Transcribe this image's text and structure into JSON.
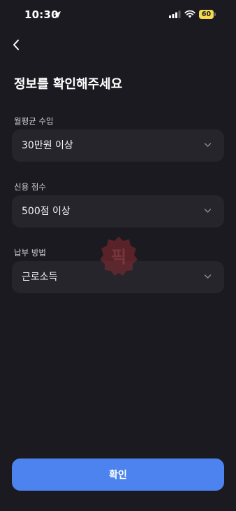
{
  "status_bar": {
    "time": "10:30",
    "battery": "60",
    "icons": [
      "location-arrow-icon",
      "signal-bars-icon",
      "wifi-icon",
      "battery-icon"
    ],
    "battery_color": "#f2d94e"
  },
  "nav": {
    "back_icon": "chevron-left-icon"
  },
  "page": {
    "title": "정보를 확인해주세요"
  },
  "fields": [
    {
      "label": "월평균 수입",
      "value": "30만원 이상"
    },
    {
      "label": "신용 점수",
      "value": "500점 이상"
    },
    {
      "label": "납부 방법",
      "value": "근로소득"
    }
  ],
  "watermark": {
    "text": "픽",
    "color": "#b3333a"
  },
  "confirm": {
    "label": "확인",
    "color": "#4d83ee"
  },
  "colors": {
    "background": "#1b1a20",
    "field_background": "#26252c"
  }
}
